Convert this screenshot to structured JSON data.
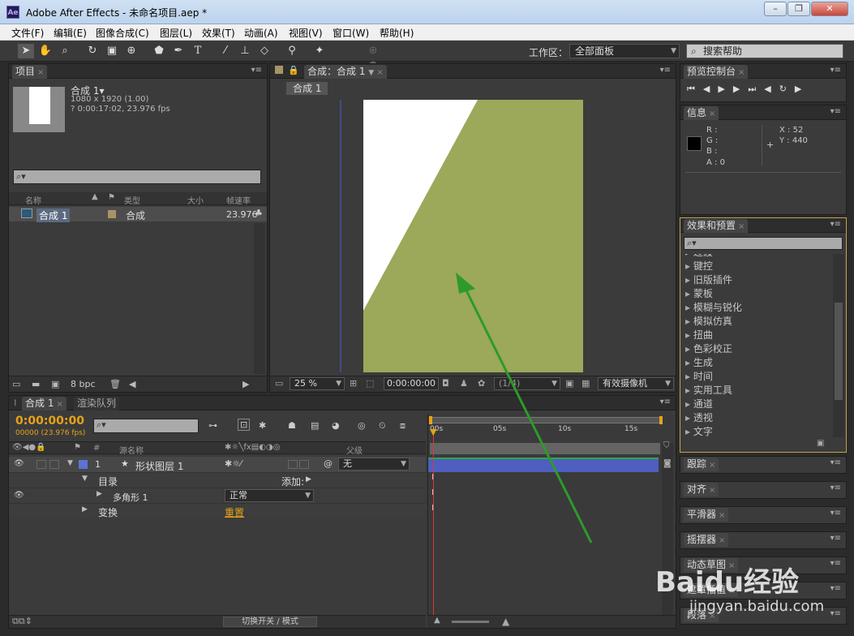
{
  "window": {
    "title": "Adobe After Effects - 未命名项目.aep *",
    "app_icon": "Ae",
    "minimize": "–",
    "restore": "❐",
    "close": "✕"
  },
  "menu": [
    "文件(F)",
    "编辑(E)",
    "图像合成(C)",
    "图层(L)",
    "效果(T)",
    "动画(A)",
    "视图(V)",
    "窗口(W)",
    "帮助(H)"
  ],
  "toolbar": {
    "workspace_label": "工作区：",
    "workspace_value": "全部面板",
    "search_help": "搜索帮助"
  },
  "project": {
    "tab": "项目",
    "comp_name": "合成 1▾",
    "comp_size": "1080 x 1920 (1.00)",
    "comp_duration": "? 0:00:17:02, 23.976 fps",
    "columns": {
      "name": "名称",
      "type": "类型",
      "size": "大小",
      "fps": "帧速率"
    },
    "rows": [
      {
        "name": "合成 1",
        "type": "合成",
        "fps": "23.976"
      }
    ],
    "bpc": "8 bpc"
  },
  "composition": {
    "tab": "合成：合成 1",
    "subtab": "合成 1",
    "zoom": "25 %",
    "timecode": "0:00:00:00",
    "resolution": "(1/4)",
    "camera": "有效摄像机",
    "fill_color": "#9ca85a"
  },
  "preview": {
    "tab": "预览控制台"
  },
  "info": {
    "tab": "信息",
    "r": "R :",
    "g": "G :",
    "b": "B :",
    "a": "A : 0",
    "x": "X : 52",
    "y": "Y : 440"
  },
  "effects": {
    "tab": "效果和预置",
    "items": [
      "过渡",
      "键控",
      "旧版插件",
      "蒙板",
      "模糊与锐化",
      "模拟仿真",
      "扭曲",
      "色彩校正",
      "生成",
      "时间",
      "实用工具",
      "通道",
      "透视",
      "文字"
    ]
  },
  "right_panels": [
    "跟踪",
    "对齐",
    "平滑器",
    "摇摆器",
    "动态草图",
    "遮罩插值",
    "段落"
  ],
  "timeline": {
    "tab_comp": "合成 1",
    "tab_render": "渲染队列",
    "timecode": "0:00:00:00",
    "fps": "00000 (23.976 fps)",
    "ruler": [
      "00s",
      "05s",
      "10s",
      "15s"
    ],
    "col_num": "#",
    "col_source": "源名称",
    "col_parent": "父级",
    "layer_num": "1",
    "layer_name": "形状图层 1",
    "parent_value": "无",
    "contents": "目录",
    "add": "添加:",
    "polygon": "多角形 1",
    "blend": "正常",
    "transform": "变换",
    "reset": "重置",
    "toggle": "切换开关 / 模式"
  },
  "watermark": {
    "brand": "Baidu经验",
    "url": "jingyan.baidu.com"
  }
}
